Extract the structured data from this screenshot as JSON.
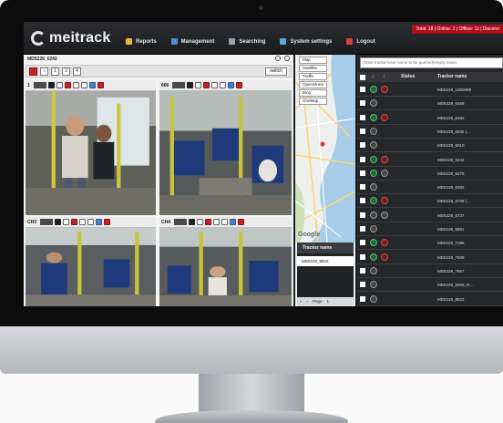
{
  "app": {
    "logo_text": "meitrack",
    "nav": [
      {
        "label": "Reports",
        "icon": "reports-icon",
        "color": "#e7b83d"
      },
      {
        "label": "Management",
        "icon": "management-icon",
        "color": "#4e8fd6"
      },
      {
        "label": "Searching",
        "icon": "search-icon",
        "color": "#9aa4b0"
      },
      {
        "label": "System settings",
        "icon": "settings-icon",
        "color": "#5aa9e0"
      },
      {
        "label": "Logout",
        "icon": "logout-icon",
        "color": "#d9433c"
      }
    ],
    "stats": "Total: 18 | Online: 2 | Offline: 11 | Disconn"
  },
  "video": {
    "title": "MD5228_6242",
    "switch_label": "switch",
    "layout_buttons": [
      "1",
      "2",
      "4"
    ],
    "cams": [
      {
        "label": "1",
        "scene": "bus-door"
      },
      {
        "label": "666",
        "scene": "bus-seats"
      },
      {
        "label": "CH3",
        "scene": "bus-rear"
      },
      {
        "label": "CH4",
        "scene": "bus-aisle"
      }
    ]
  },
  "map": {
    "buttons": [
      "Map",
      "Satellite",
      "Traffic",
      "OpenStreet",
      "Bing",
      "OneMap"
    ],
    "provider": "Google",
    "tracker_panel": {
      "header": "Tracker name",
      "rows": [
        "MD5228_8922"
      ],
      "page_label": "Page",
      "page_value": "1"
    }
  },
  "list": {
    "search_placeholder": "Enter tracker/user name to be queried(empty mean",
    "headers": {
      "status": "Status",
      "name": "Tracker name"
    },
    "rows": [
      {
        "name": "MD5228_1000089",
        "icons": [
          "green",
          "red"
        ]
      },
      {
        "name": "MD5228_6468",
        "icons": [
          "grey"
        ]
      },
      {
        "name": "MD5228_6492",
        "icons": [
          "green",
          "red"
        ]
      },
      {
        "name": "MD5228_5636 (…",
        "icons": [
          "grey"
        ]
      },
      {
        "name": "MD5228_6010",
        "icons": [
          "grey"
        ]
      },
      {
        "name": "MD5228_6242",
        "icons": [
          "green",
          "red"
        ]
      },
      {
        "name": "MD5228_6276",
        "icons": [
          "green",
          "grey"
        ]
      },
      {
        "name": "MD5228_6382",
        "icons": [
          "grey"
        ]
      },
      {
        "name": "MD5228_6709 (…",
        "icons": [
          "green",
          "red"
        ]
      },
      {
        "name": "MD5228_6737",
        "icons": [
          "grey",
          "grey"
        ]
      },
      {
        "name": "MD5228_6881",
        "icons": [
          "grey"
        ]
      },
      {
        "name": "MD5228_7186",
        "icons": [
          "green",
          "red"
        ]
      },
      {
        "name": "MD5228_7608",
        "icons": [
          "green",
          "red"
        ]
      },
      {
        "name": "MD5228_7667",
        "icons": [
          "grey"
        ]
      },
      {
        "name": "MD5228_8305_R…",
        "icons": [
          "grey"
        ]
      },
      {
        "name": "MD5228_8922",
        "icons": [
          "grey"
        ]
      }
    ]
  }
}
